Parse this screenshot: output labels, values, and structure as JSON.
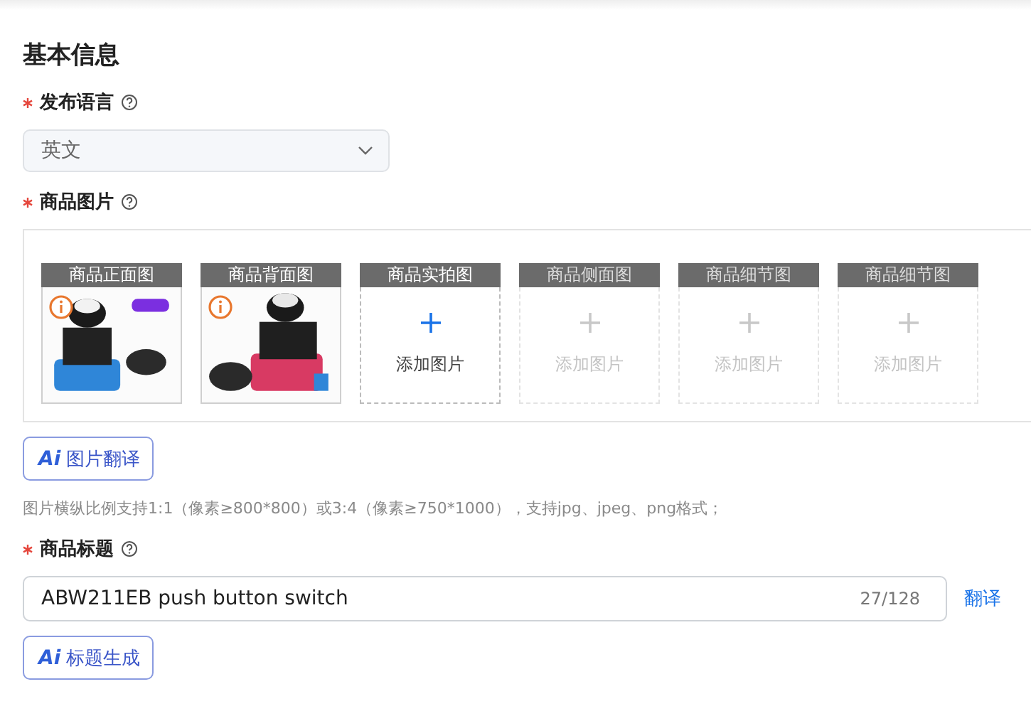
{
  "section_title": "基本信息",
  "language": {
    "label": "发布语言",
    "required": true,
    "value": "英文"
  },
  "images": {
    "label": "商品图片",
    "required": true,
    "slots": [
      {
        "title": "商品正面图",
        "disabled": false
      },
      {
        "title": "商品背面图",
        "disabled": false
      },
      {
        "title": "商品实拍图",
        "kind": "empty",
        "action": "添加图片",
        "disabled": false
      },
      {
        "title": "商品侧面图",
        "kind": "empty",
        "action": "添加图片",
        "disabled": true
      },
      {
        "title": "商品细节图",
        "kind": "empty",
        "action": "添加图片",
        "disabled": true
      },
      {
        "title": "商品细节图",
        "kind": "empty",
        "action": "添加图片",
        "disabled": true
      }
    ],
    "ai_button": {
      "badge": "Ai",
      "label": "图片翻译"
    },
    "hint": "图片横纵比例支持1:1（像素≥800*800）或3:4（像素≥750*1000），支持jpg、jpeg、png格式；"
  },
  "title": {
    "label": "商品标题",
    "required": true,
    "value": "ABW211EB push button switch",
    "counter": "27/128",
    "translate": "翻译",
    "ai_button": {
      "badge": "Ai",
      "label": "标题生成"
    }
  }
}
